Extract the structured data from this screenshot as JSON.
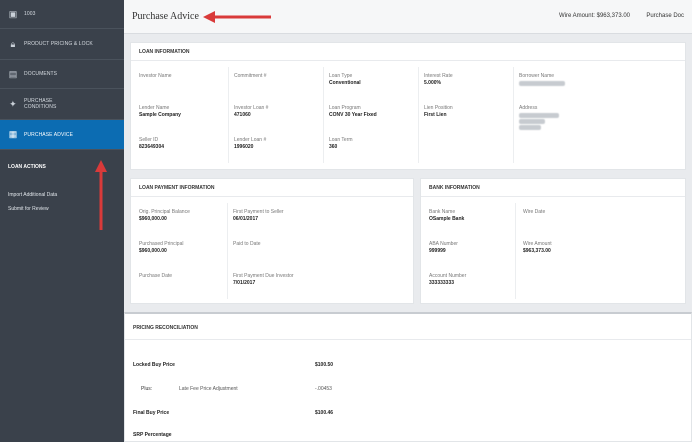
{
  "sidebar": {
    "items": [
      {
        "label": "1003",
        "icon": "document-icon"
      },
      {
        "label": "PRODUCT PRICING & LOCK",
        "icon": "lock-icon"
      },
      {
        "label": "DOCUMENTS",
        "icon": "file-icon"
      },
      {
        "label": "PURCHASE CONDITIONS",
        "icon": "settings-icon"
      },
      {
        "label": "PURCHASE ADVICE",
        "icon": "list-icon"
      }
    ],
    "loan_actions": {
      "header": "LOAN ACTIONS",
      "links": [
        "Import Additional Data",
        "Submit for Review"
      ]
    }
  },
  "header": {
    "title": "Purchase Advice",
    "wire_amount": "Wire Amount: $963,373.00",
    "purchase_doc": "Purchase Doc"
  },
  "loan_info": {
    "title": "LOAN INFORMATION",
    "investor_name": {
      "label": "Investor Name",
      "value": ""
    },
    "commitment": {
      "label": "Commitment #",
      "value": ""
    },
    "loan_type": {
      "label": "Loan Type",
      "value": "Conventional"
    },
    "interest_rate": {
      "label": "Interest Rate",
      "value": "5.000%"
    },
    "borrower_name": {
      "label": "Borrower Name",
      "value": ""
    },
    "lender_name": {
      "label": "Lender Name",
      "value": "Sample Company"
    },
    "investor_loan": {
      "label": "Investor Loan #",
      "value": "471060"
    },
    "loan_program": {
      "label": "Loan Program",
      "value": "CONV 30 Year Fixed"
    },
    "lien_position": {
      "label": "Lien Position",
      "value": "First Lien"
    },
    "address": {
      "label": "Address",
      "value": ""
    },
    "seller_id": {
      "label": "Seller ID",
      "value": "823649304"
    },
    "lender_loan": {
      "label": "Lender Loan #",
      "value": "1996020"
    },
    "loan_term": {
      "label": "Loan Term",
      "value": "360"
    }
  },
  "payment_info": {
    "title": "LOAN PAYMENT INFORMATION",
    "orig_principal": {
      "label": "Orig. Principal Balance",
      "value": "$960,000.00"
    },
    "first_payment_seller": {
      "label": "First Payment to Seller",
      "value": "06/01/2017"
    },
    "purchased_principal": {
      "label": "Purchased Principal",
      "value": "$960,000.00"
    },
    "paid_to_date": {
      "label": "Paid to Date",
      "value": ""
    },
    "purchase_date": {
      "label": "Purchase Date",
      "value": ""
    },
    "first_payment_investor": {
      "label": "First Payment Due Investor",
      "value": "7/01/2017"
    }
  },
  "bank_info": {
    "title": "BANK INFORMATION",
    "bank_name": {
      "label": "Bank Name",
      "value": "OSample Bank"
    },
    "wire_date": {
      "label": "Wire Date",
      "value": ""
    },
    "aba": {
      "label": "ABA Number",
      "value": "999999"
    },
    "wire_amount": {
      "label": "Wire Amount",
      "value": "$963,373.00"
    },
    "account": {
      "label": "Account Number",
      "value": "333333333"
    }
  },
  "pricing": {
    "title": "PRICING RECONCILIATION",
    "locked_buy_price": {
      "label": "Locked Buy Price",
      "value": "$100.50"
    },
    "plus_label": "Plus:",
    "adjustment": {
      "label": "Late Fee Price Adjustment",
      "value": "-.00453"
    },
    "final_buy_price": {
      "label": "Final Buy Price",
      "value": "$100.46"
    },
    "srp_percentage": {
      "label": "SRP Percentage",
      "value": ""
    }
  },
  "colors": {
    "accent": "#0c6cb2",
    "sidebar": "#3a414b",
    "annotation": "#d93a3a"
  }
}
